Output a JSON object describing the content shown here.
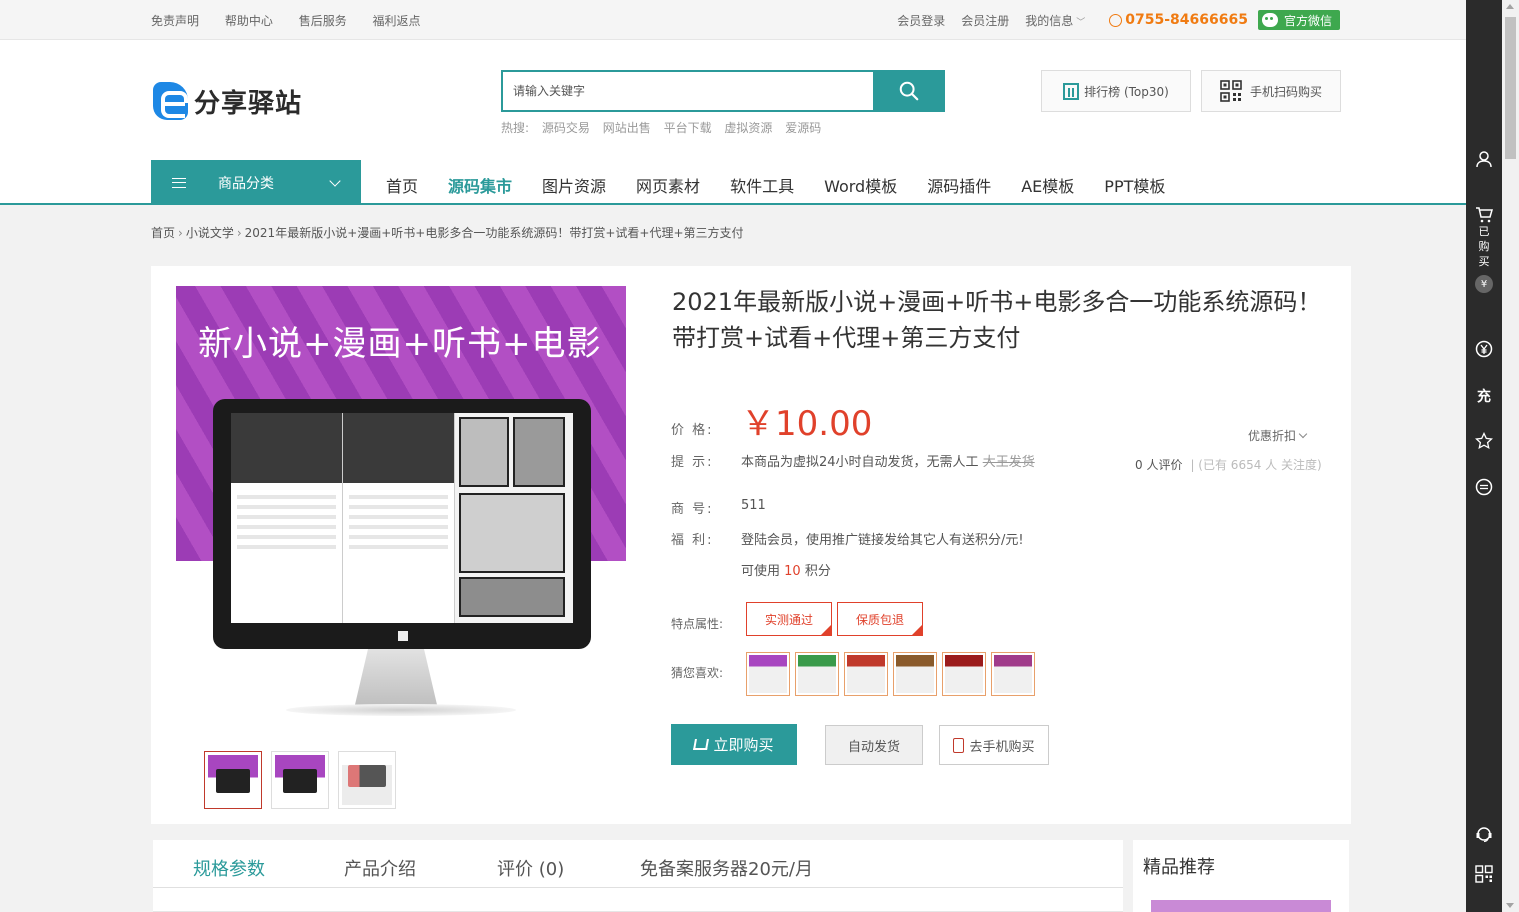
{
  "topbar": {
    "left_links": [
      "免责声明",
      "帮助中心",
      "售后服务",
      "福利返点"
    ],
    "login": "会员登录",
    "register": "会员注册",
    "my_info": "我的信息",
    "phone": "0755-84666665",
    "wechat": "官方微信"
  },
  "header": {
    "logo_text": "分享驿站",
    "search_placeholder": "请输入关键字",
    "hot_label": "热搜:",
    "hot_words": [
      "源码交易",
      "网站出售",
      "平台下载",
      "虚拟资源",
      "爱源码"
    ],
    "rank_button": "排行榜 (Top30)",
    "scan_button": "手机扫码购买"
  },
  "nav": {
    "category_button": "商品分类",
    "items": [
      "首页",
      "源码集市",
      "图片资源",
      "网页素材",
      "软件工具",
      "Word模板",
      "源码插件",
      "AE模板",
      "PPT模板"
    ],
    "active_index": 1
  },
  "breadcrumb": {
    "home": "首页",
    "category": "小说文学",
    "current": "2021年最新版小说+漫画+听书+电影多合一功能系统源码！带打赏+试看+代理+第三方支付"
  },
  "product": {
    "image_banner_text": "新小说+漫画+听书+电影",
    "title": "2021年最新版小说+漫画+听书+电影多合一功能系统源码！带打赏+试看+代理+第三方支付",
    "price_label": "价 格:",
    "price": "￥10.00",
    "tip_label": "提 示:",
    "tip_text": "本商品为虚拟24小时自动发货，无需人工",
    "tip_strike": "大王发货",
    "discount": "优惠折扣",
    "reviews": "0 人评价",
    "followers": "| (已有 6654 人 关注度)",
    "sku_label": "商 号:",
    "sku": "511",
    "benefit_label": "福 利:",
    "benefit_text": "登陆会员，使用推广链接发给其它人有送积分/元!",
    "points_prefix": "可使用",
    "points_value": "10",
    "points_suffix": "积分",
    "features_label": "特点属性:",
    "features": [
      "实测通过",
      "保质包退"
    ],
    "guess_label": "猜您喜欢:",
    "guess_colors": [
      "#a846c0",
      "#3a9a4a",
      "#c0392b",
      "#8a5a2b",
      "#9b1b1b",
      "#a03b8a"
    ],
    "buy_button": "立即购买",
    "auto_button": "自动发货",
    "mobile_button": "去手机购买"
  },
  "tabs": {
    "items": [
      "规格参数",
      "产品介绍",
      "评价 (0)",
      "免备案服务器20元/月"
    ],
    "active_index": 0
  },
  "recommend": {
    "title": "精品推荐"
  },
  "sidebar": {
    "cart_label": "已购买",
    "yen_badge": "¥",
    "recharge": "充"
  }
}
